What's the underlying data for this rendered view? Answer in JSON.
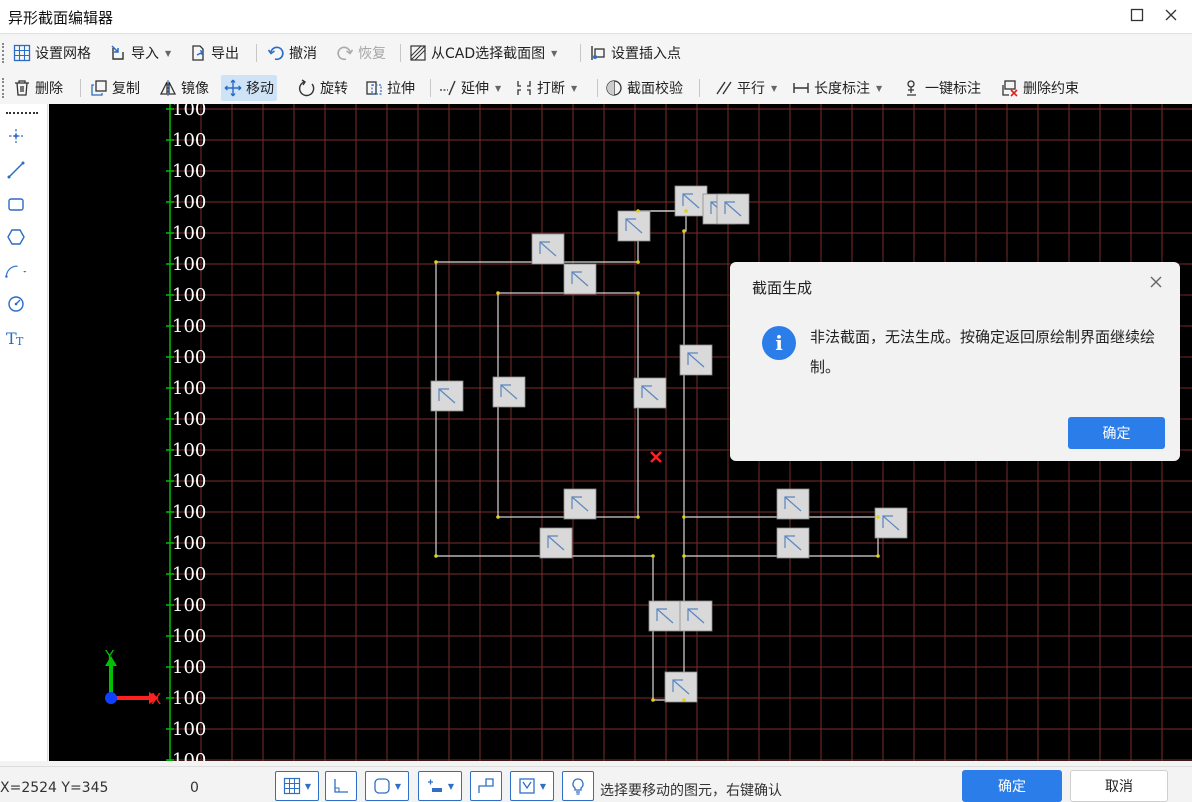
{
  "window": {
    "title": "异形截面编辑器",
    "maximize_icon": "maximize-icon",
    "close_icon": "close-icon"
  },
  "toolbar1": [
    {
      "label": "设置网格",
      "icon": "grid-icon"
    },
    {
      "label": "导入",
      "icon": "import-icon",
      "dropdown": true
    },
    {
      "label": "导出",
      "icon": "export-icon"
    },
    {
      "label": "撤消",
      "icon": "undo-icon"
    },
    {
      "label": "恢复",
      "icon": "redo-icon",
      "disabled": true
    },
    {
      "label": "从CAD选择截面图",
      "icon": "cad-select-icon",
      "dropdown": true
    },
    {
      "label": "设置插入点",
      "icon": "insert-point-icon"
    }
  ],
  "toolbar2": [
    {
      "label": "删除",
      "icon": "delete-icon"
    },
    {
      "label": "复制",
      "icon": "copy-icon"
    },
    {
      "label": "镜像",
      "icon": "mirror-icon"
    },
    {
      "label": "移动",
      "icon": "move-icon",
      "active": true
    },
    {
      "label": "旋转",
      "icon": "rotate-icon"
    },
    {
      "label": "拉伸",
      "icon": "stretch-icon"
    },
    {
      "label": "延伸",
      "icon": "extend-icon",
      "dropdown": true
    },
    {
      "label": "打断",
      "icon": "break-icon",
      "dropdown": true
    },
    {
      "label": "截面校验",
      "icon": "section-check-icon"
    },
    {
      "label": "平行",
      "icon": "parallel-icon",
      "dropdown": true
    },
    {
      "label": "长度标注",
      "icon": "length-dimension-icon",
      "dropdown": true
    },
    {
      "label": "一键标注",
      "icon": "auto-dimension-icon"
    },
    {
      "label": "删除约束",
      "icon": "delete-constraint-icon"
    }
  ],
  "left_tools": [
    "point-icon",
    "line-icon",
    "rectangle-icon",
    "polygon-icon",
    "arc-icon",
    "circle-icon",
    "text-icon"
  ],
  "canvas": {
    "grid_labels": [
      "100",
      "100",
      "100",
      "100",
      "100",
      "100",
      "100",
      "100",
      "100",
      "100",
      "100",
      "100",
      "100",
      "100",
      "100",
      "100",
      "100",
      "100",
      "100",
      "100",
      "100",
      "100"
    ],
    "axis_x_label": "X",
    "axis_y_label": "Y"
  },
  "dialog": {
    "title": "截面生成",
    "message": "非法截面，无法生成。按确定返回原绘制界面继续绘制。",
    "ok_label": "确定",
    "info_icon_glyph": "i"
  },
  "status": {
    "coords": "X=2524 Y=345",
    "value": "0",
    "hint": "选择要移动的图元，右键确认",
    "ok_label": "确定",
    "cancel_label": "取消",
    "snap_buttons": [
      "grid-snap-icon",
      "ortho-icon",
      "object-snap-icon",
      "dimension-snap-icon",
      "polyline-snap-icon",
      "constraint-icon",
      "tip-icon"
    ]
  },
  "colors": {
    "accent": "#2b7de9",
    "grid_line": "#7a2d2d",
    "axis_green": "#00c000",
    "axis_red": "#ff2020",
    "shape_line": "#d8d8d8",
    "vertex": "#e0d020"
  }
}
